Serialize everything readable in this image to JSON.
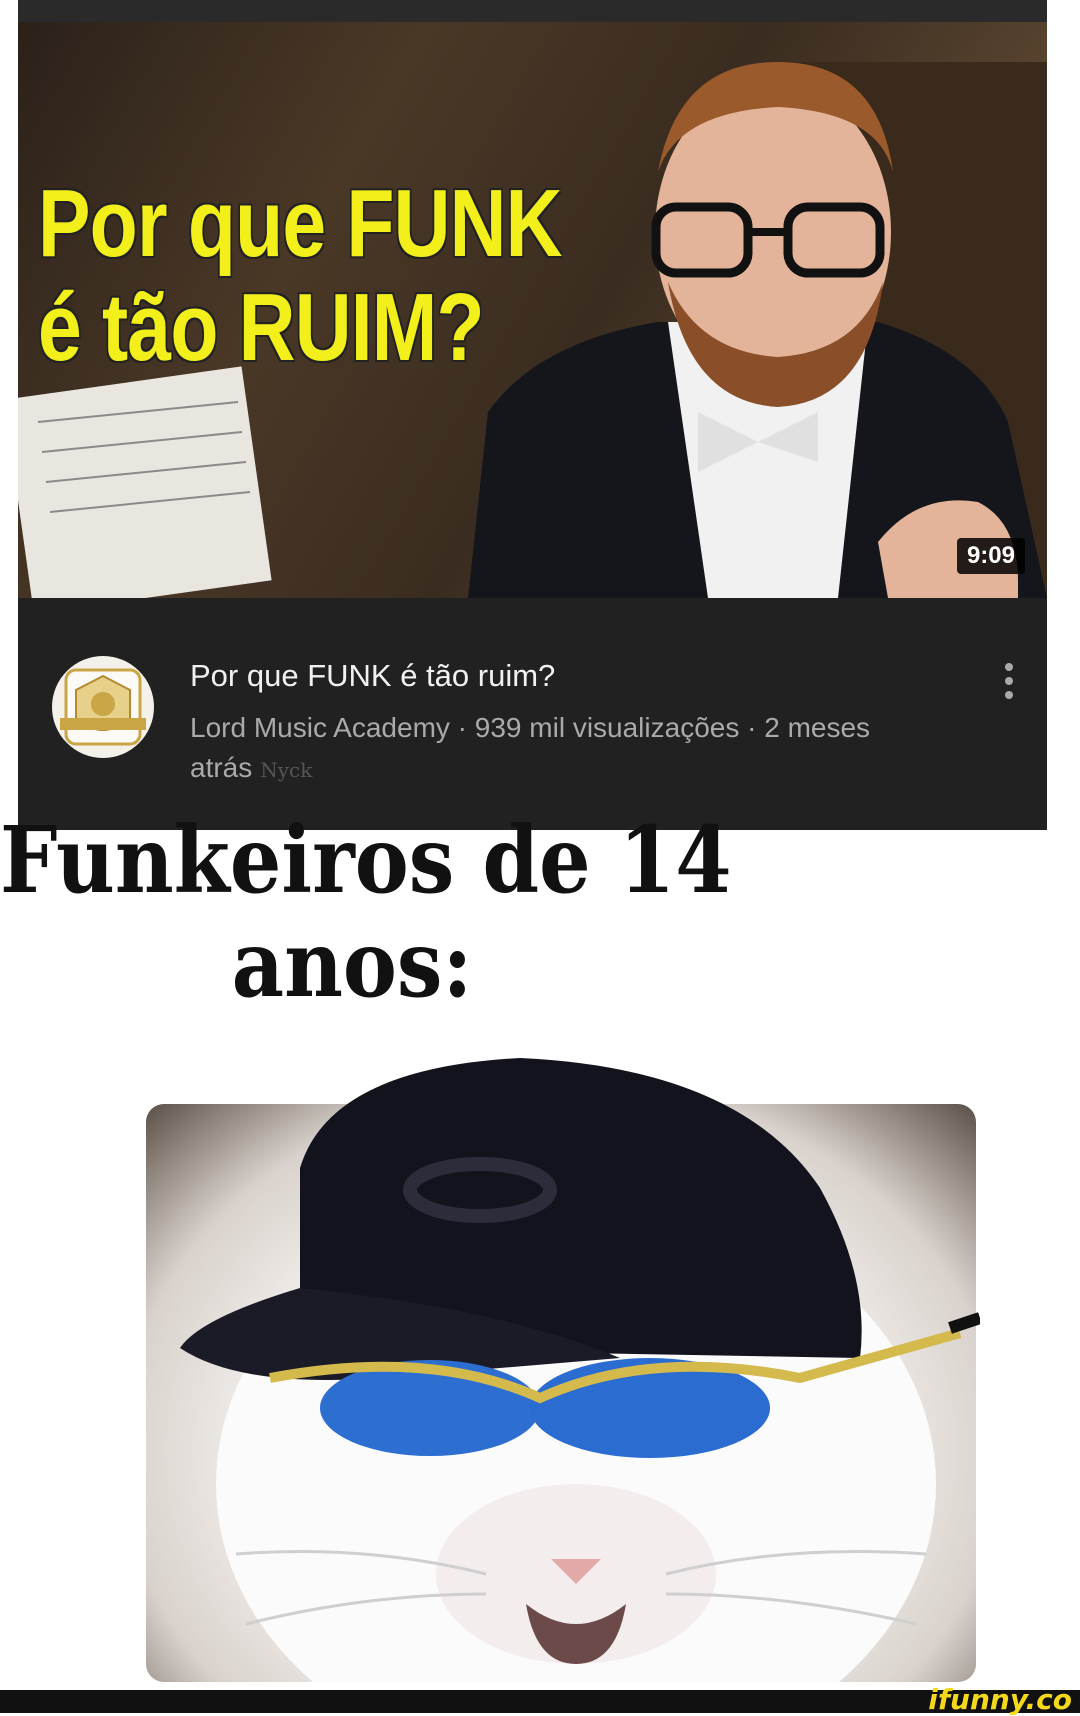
{
  "video": {
    "thumbnail_text_line1": "Por que FUNK",
    "thumbnail_text_line2": "é tão RUIM?",
    "duration": "9:09",
    "title": "Por que FUNK é tão ruim?",
    "info": "Lord Music Academy · 939 mil visualizações · 2 meses atrás",
    "watermark": "Nyck"
  },
  "caption": {
    "line1": "Funkeiros de 14",
    "line2": "anos:"
  },
  "footer": {
    "brand": "ifunny.co"
  },
  "colors": {
    "thumbnail_text": "#f2ef1a",
    "card_bg": "#212121",
    "brand": "#f4d91b"
  },
  "icons": [
    "more-vert-icon",
    "channel-logo-icon"
  ]
}
